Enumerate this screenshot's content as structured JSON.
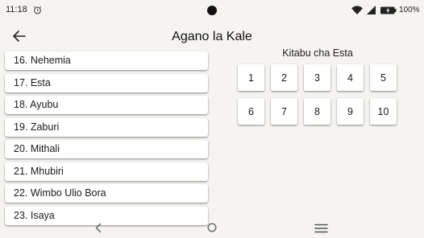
{
  "status": {
    "time": "11:18",
    "battery": "100%"
  },
  "header": {
    "title": "Agano la Kale"
  },
  "books": [
    {
      "label": "16. Nehemia"
    },
    {
      "label": "17. Esta"
    },
    {
      "label": "18. Ayubu"
    },
    {
      "label": "19. Zaburi"
    },
    {
      "label": "20. Mithali"
    },
    {
      "label": "21. Mhubiri"
    },
    {
      "label": "22. Wimbo Ulio Bora"
    },
    {
      "label": "23. Isaya"
    }
  ],
  "chapters": {
    "title": "Kitabu cha Esta",
    "items": [
      "1",
      "2",
      "3",
      "4",
      "5",
      "6",
      "7",
      "8",
      "9",
      "10"
    ]
  },
  "icons": {
    "status": [
      "alarm-icon",
      "wifi-icon",
      "signal-icon",
      "battery-icon"
    ],
    "appbar": [
      "back-arrow-icon"
    ],
    "navbar": [
      "nav-back-icon",
      "nav-home-icon",
      "nav-menu-icon"
    ]
  }
}
